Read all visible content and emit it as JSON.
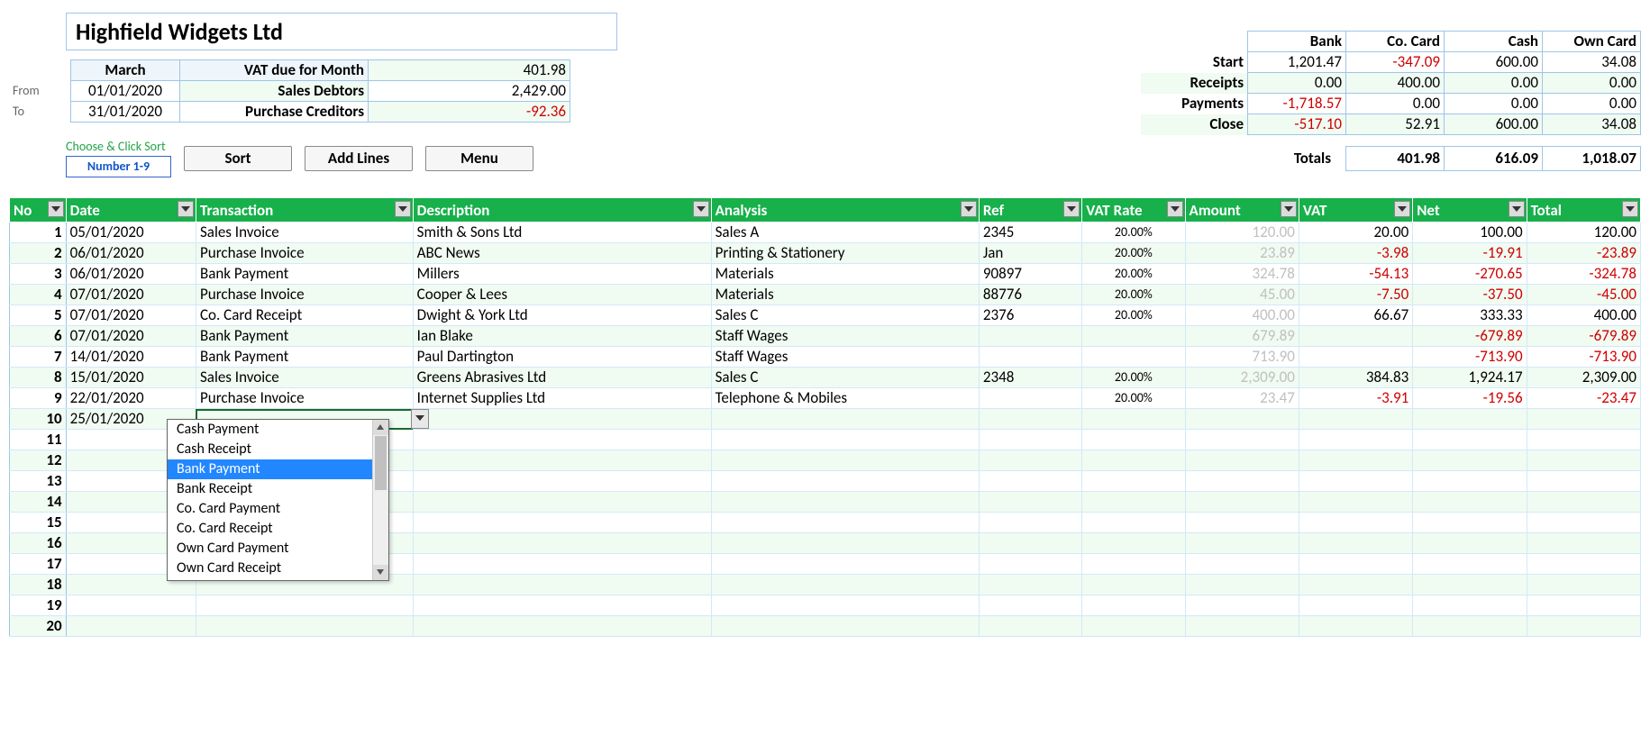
{
  "company": "Highfield Widgets Ltd",
  "period_labels": {
    "from": "From",
    "to": "To"
  },
  "month": "March",
  "from": "01/01/2020",
  "to": "31/01/2020",
  "vat_due_label": "VAT due for Month",
  "vat_due": "401.98",
  "sales_debtors_label": "Sales Debtors",
  "sales_debtors": "2,429.00",
  "purchase_creditors_label": "Purchase Creditors",
  "purchase_creditors": "-92.36",
  "sort_caption": "Choose & Click Sort",
  "sort_value": "Number  1-9",
  "buttons": {
    "sort": "Sort",
    "add_lines": "Add Lines",
    "menu": "Menu"
  },
  "summary": {
    "cols": [
      "Bank",
      "Co. Card",
      "Cash",
      "Own Card"
    ],
    "rows": [
      {
        "label": "Start",
        "vals": [
          "1,201.47",
          "-347.09",
          "600.00",
          "34.08"
        ]
      },
      {
        "label": "Receipts",
        "vals": [
          "0.00",
          "400.00",
          "0.00",
          "0.00"
        ]
      },
      {
        "label": "Payments",
        "vals": [
          "-1,718.57",
          "0.00",
          "0.00",
          "0.00"
        ]
      },
      {
        "label": "Close",
        "vals": [
          "-517.10",
          "52.91",
          "600.00",
          "34.08"
        ]
      }
    ],
    "totals_label": "Totals",
    "totals": [
      "401.98",
      "616.09",
      "1,018.07"
    ]
  },
  "grid_headers": [
    "No",
    "Date",
    "Transaction",
    "Description",
    "Analysis",
    "Ref",
    "VAT Rate",
    "Amount",
    "VAT",
    "Net",
    "Total"
  ],
  "grid_rows": [
    {
      "no": "1",
      "date": "05/01/2020",
      "trn": "Sales Invoice",
      "desc": "Smith & Sons Ltd",
      "ana": "Sales A",
      "ref": "2345",
      "vr": "20.00%",
      "amt": "120.00",
      "vat": "20.00",
      "net": "100.00",
      "tot": "120.00"
    },
    {
      "no": "2",
      "date": "06/01/2020",
      "trn": "Purchase Invoice",
      "desc": "ABC News",
      "ana": "Printing & Stationery",
      "ref": "Jan",
      "vr": "20.00%",
      "amt": "23.89",
      "vat": "-3.98",
      "net": "-19.91",
      "tot": "-23.89"
    },
    {
      "no": "3",
      "date": "06/01/2020",
      "trn": "Bank Payment",
      "desc": "Millers",
      "ana": "Materials",
      "ref": "90897",
      "vr": "20.00%",
      "amt": "324.78",
      "vat": "-54.13",
      "net": "-270.65",
      "tot": "-324.78"
    },
    {
      "no": "4",
      "date": "07/01/2020",
      "trn": "Purchase Invoice",
      "desc": "Cooper & Lees",
      "ana": "Materials",
      "ref": "88776",
      "vr": "20.00%",
      "amt": "45.00",
      "vat": "-7.50",
      "net": "-37.50",
      "tot": "-45.00"
    },
    {
      "no": "5",
      "date": "07/01/2020",
      "trn": "Co. Card Receipt",
      "desc": "Dwight & York Ltd",
      "ana": "Sales C",
      "ref": "2376",
      "vr": "20.00%",
      "amt": "400.00",
      "vat": "66.67",
      "net": "333.33",
      "tot": "400.00"
    },
    {
      "no": "6",
      "date": "07/01/2020",
      "trn": "Bank Payment",
      "desc": "Ian Blake",
      "ana": "Staff Wages",
      "ref": "",
      "vr": "",
      "amt": "679.89",
      "vat": "",
      "net": "-679.89",
      "tot": "-679.89"
    },
    {
      "no": "7",
      "date": "14/01/2020",
      "trn": "Bank Payment",
      "desc": "Paul Dartington",
      "ana": "Staff Wages",
      "ref": "",
      "vr": "",
      "amt": "713.90",
      "vat": "",
      "net": "-713.90",
      "tot": "-713.90"
    },
    {
      "no": "8",
      "date": "15/01/2020",
      "trn": "Sales Invoice",
      "desc": "Greens Abrasives Ltd",
      "ana": "Sales C",
      "ref": "2348",
      "vr": "20.00%",
      "amt": "2,309.00",
      "vat": "384.83",
      "net": "1,924.17",
      "tot": "2,309.00"
    },
    {
      "no": "9",
      "date": "22/01/2020",
      "trn": "Purchase Invoice",
      "desc": "Internet Supplies Ltd",
      "ana": "Telephone & Mobiles",
      "ref": "",
      "vr": "20.00%",
      "amt": "23.47",
      "vat": "-3.91",
      "net": "-19.56",
      "tot": "-23.47"
    },
    {
      "no": "10",
      "date": "25/01/2020",
      "trn": "",
      "desc": "",
      "ana": "",
      "ref": "",
      "vr": "",
      "amt": "",
      "vat": "",
      "net": "",
      "tot": ""
    },
    {
      "no": "11"
    },
    {
      "no": "12"
    },
    {
      "no": "13"
    },
    {
      "no": "14"
    },
    {
      "no": "15"
    },
    {
      "no": "16"
    },
    {
      "no": "17"
    },
    {
      "no": "18"
    },
    {
      "no": "19"
    },
    {
      "no": "20"
    }
  ],
  "dropdown": {
    "options": [
      "Cash Payment",
      "Cash Receipt",
      "Bank Payment",
      "Bank Receipt",
      "Co. Card Payment",
      "Co. Card Receipt",
      "Own Card Payment",
      "Own Card Receipt"
    ],
    "selected_index": 2
  }
}
